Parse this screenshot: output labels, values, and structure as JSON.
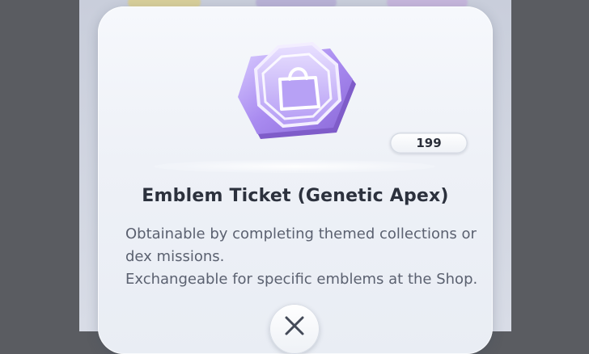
{
  "item": {
    "name": "Emblem Ticket (Genetic Apex)",
    "count": "199",
    "description_lines": [
      "Obtainable by completing themed collections or",
      "dex missions.",
      "Exchangeable for specific emblems at the Shop."
    ],
    "icon": "shopping-bag-icon"
  },
  "colors": {
    "ticket_purple": "#a98bf0",
    "ticket_light": "#d9ccff",
    "ticket_dark": "#7f5cc9",
    "title_text": "#2c313d",
    "body_text": "#5b6170"
  },
  "controls": {
    "close_icon": "close-icon"
  }
}
